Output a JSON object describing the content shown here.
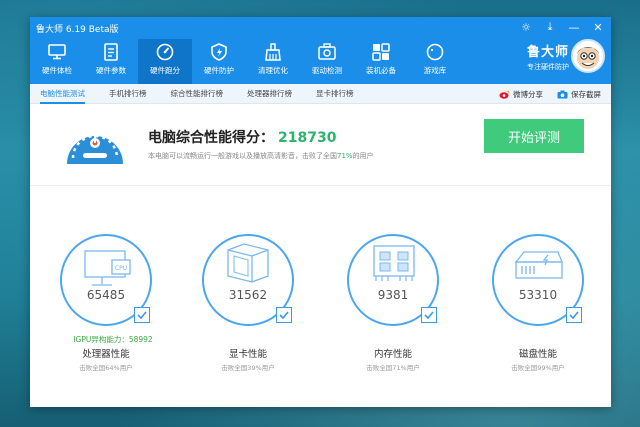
{
  "window": {
    "title": "鲁大师 6.19 Beta版",
    "controls": [
      "☼",
      "⤓",
      "—",
      "✕"
    ]
  },
  "nav": [
    {
      "label": "硬件体检",
      "icon": "monitor-icon"
    },
    {
      "label": "硬件参数",
      "icon": "document-icon"
    },
    {
      "label": "硬件跑分",
      "icon": "speedometer-icon",
      "active": true
    },
    {
      "label": "硬件防护",
      "icon": "shield-icon"
    },
    {
      "label": "清理优化",
      "icon": "broom-icon"
    },
    {
      "label": "驱动检测",
      "icon": "gear-box-icon"
    },
    {
      "label": "装机必备",
      "icon": "apps-icon"
    },
    {
      "label": "游戏库",
      "icon": "gamepad-icon"
    }
  ],
  "brand": {
    "title": "鲁大师",
    "subtitle": "专注硬件防护"
  },
  "tabs": [
    {
      "label": "电脑性能测试",
      "active": true
    },
    {
      "label": "手机排行榜"
    },
    {
      "label": "综合性能排行榜"
    },
    {
      "label": "处理器排行榜"
    },
    {
      "label": "显卡排行榜"
    }
  ],
  "tab_actions": {
    "share": "微博分享",
    "save": "保存截屏"
  },
  "score": {
    "title": "电脑综合性能得分：",
    "value": "218730",
    "desc_pre": "本电脑可以流畅运行一般游戏以及播放高清影音，击败了全国",
    "percent": "71%",
    "desc_post": "的用户",
    "button": "开始评测"
  },
  "cards": [
    {
      "value": "65485",
      "name": "处理器性能",
      "sub": "击败全国64%用户",
      "extra": "IGPU异构能力：58992",
      "icon": "cpu-monitor-icon"
    },
    {
      "value": "31562",
      "name": "显卡性能",
      "sub": "击败全国39%用户",
      "icon": "gpu-cube-icon"
    },
    {
      "value": "9381",
      "name": "内存性能",
      "sub": "击败全国71%用户",
      "icon": "memory-icon"
    },
    {
      "value": "53310",
      "name": "磁盘性能",
      "sub": "击败全国99%用户",
      "icon": "disk-icon"
    }
  ],
  "colors": {
    "accent": "#1a8ee8",
    "green": "#2db36c",
    "button": "#3fca7c"
  }
}
